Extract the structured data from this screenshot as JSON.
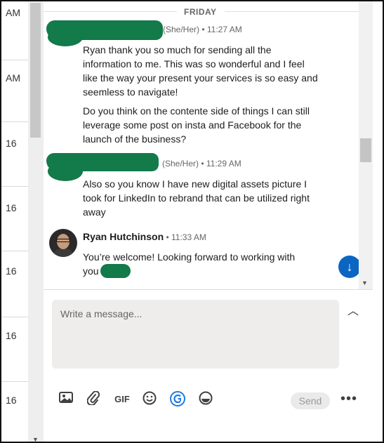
{
  "left_list": {
    "times": [
      "AM",
      "AM",
      "16",
      "16",
      "16",
      "16",
      "16"
    ]
  },
  "conversation": {
    "day_label": "FRIDAY",
    "messages": [
      {
        "sender_meta": "(She/Her) • 11:27 AM",
        "paragraphs": [
          "Ryan thank you so much for sending all the information to me. This was so wonderful and I feel like the way your present your services is so easy and seemless to navigate!",
          "Do you think on the contente side of things I can still leverage some post on insta and Facebook for the launch of the business?"
        ]
      },
      {
        "sender_meta": "(She/Her) • 11:29 AM",
        "paragraphs": [
          "Also so you know I have new digital assets picture I took for LinkedIn to rebrand that can be utilized right away"
        ]
      },
      {
        "sender_name": "Ryan Hutchinson",
        "sender_time": "• 11:33 AM",
        "paragraphs": [
          "You’re welcome! Looking forward to working with you"
        ]
      }
    ],
    "jump_icon": "arrow-down-icon"
  },
  "compose": {
    "placeholder": "Write a message...",
    "expand_icon": "chevron-up-icon",
    "gif_label": "GIF",
    "send_label": "Send",
    "more_label": "•••",
    "icons": [
      "image-icon",
      "paperclip-icon",
      "gif-icon",
      "emoji-icon",
      "grammarly-icon",
      "sticker-icon",
      "more-icon"
    ]
  },
  "colors": {
    "accent": "#0a66c2",
    "redaction": "#137a4a"
  }
}
